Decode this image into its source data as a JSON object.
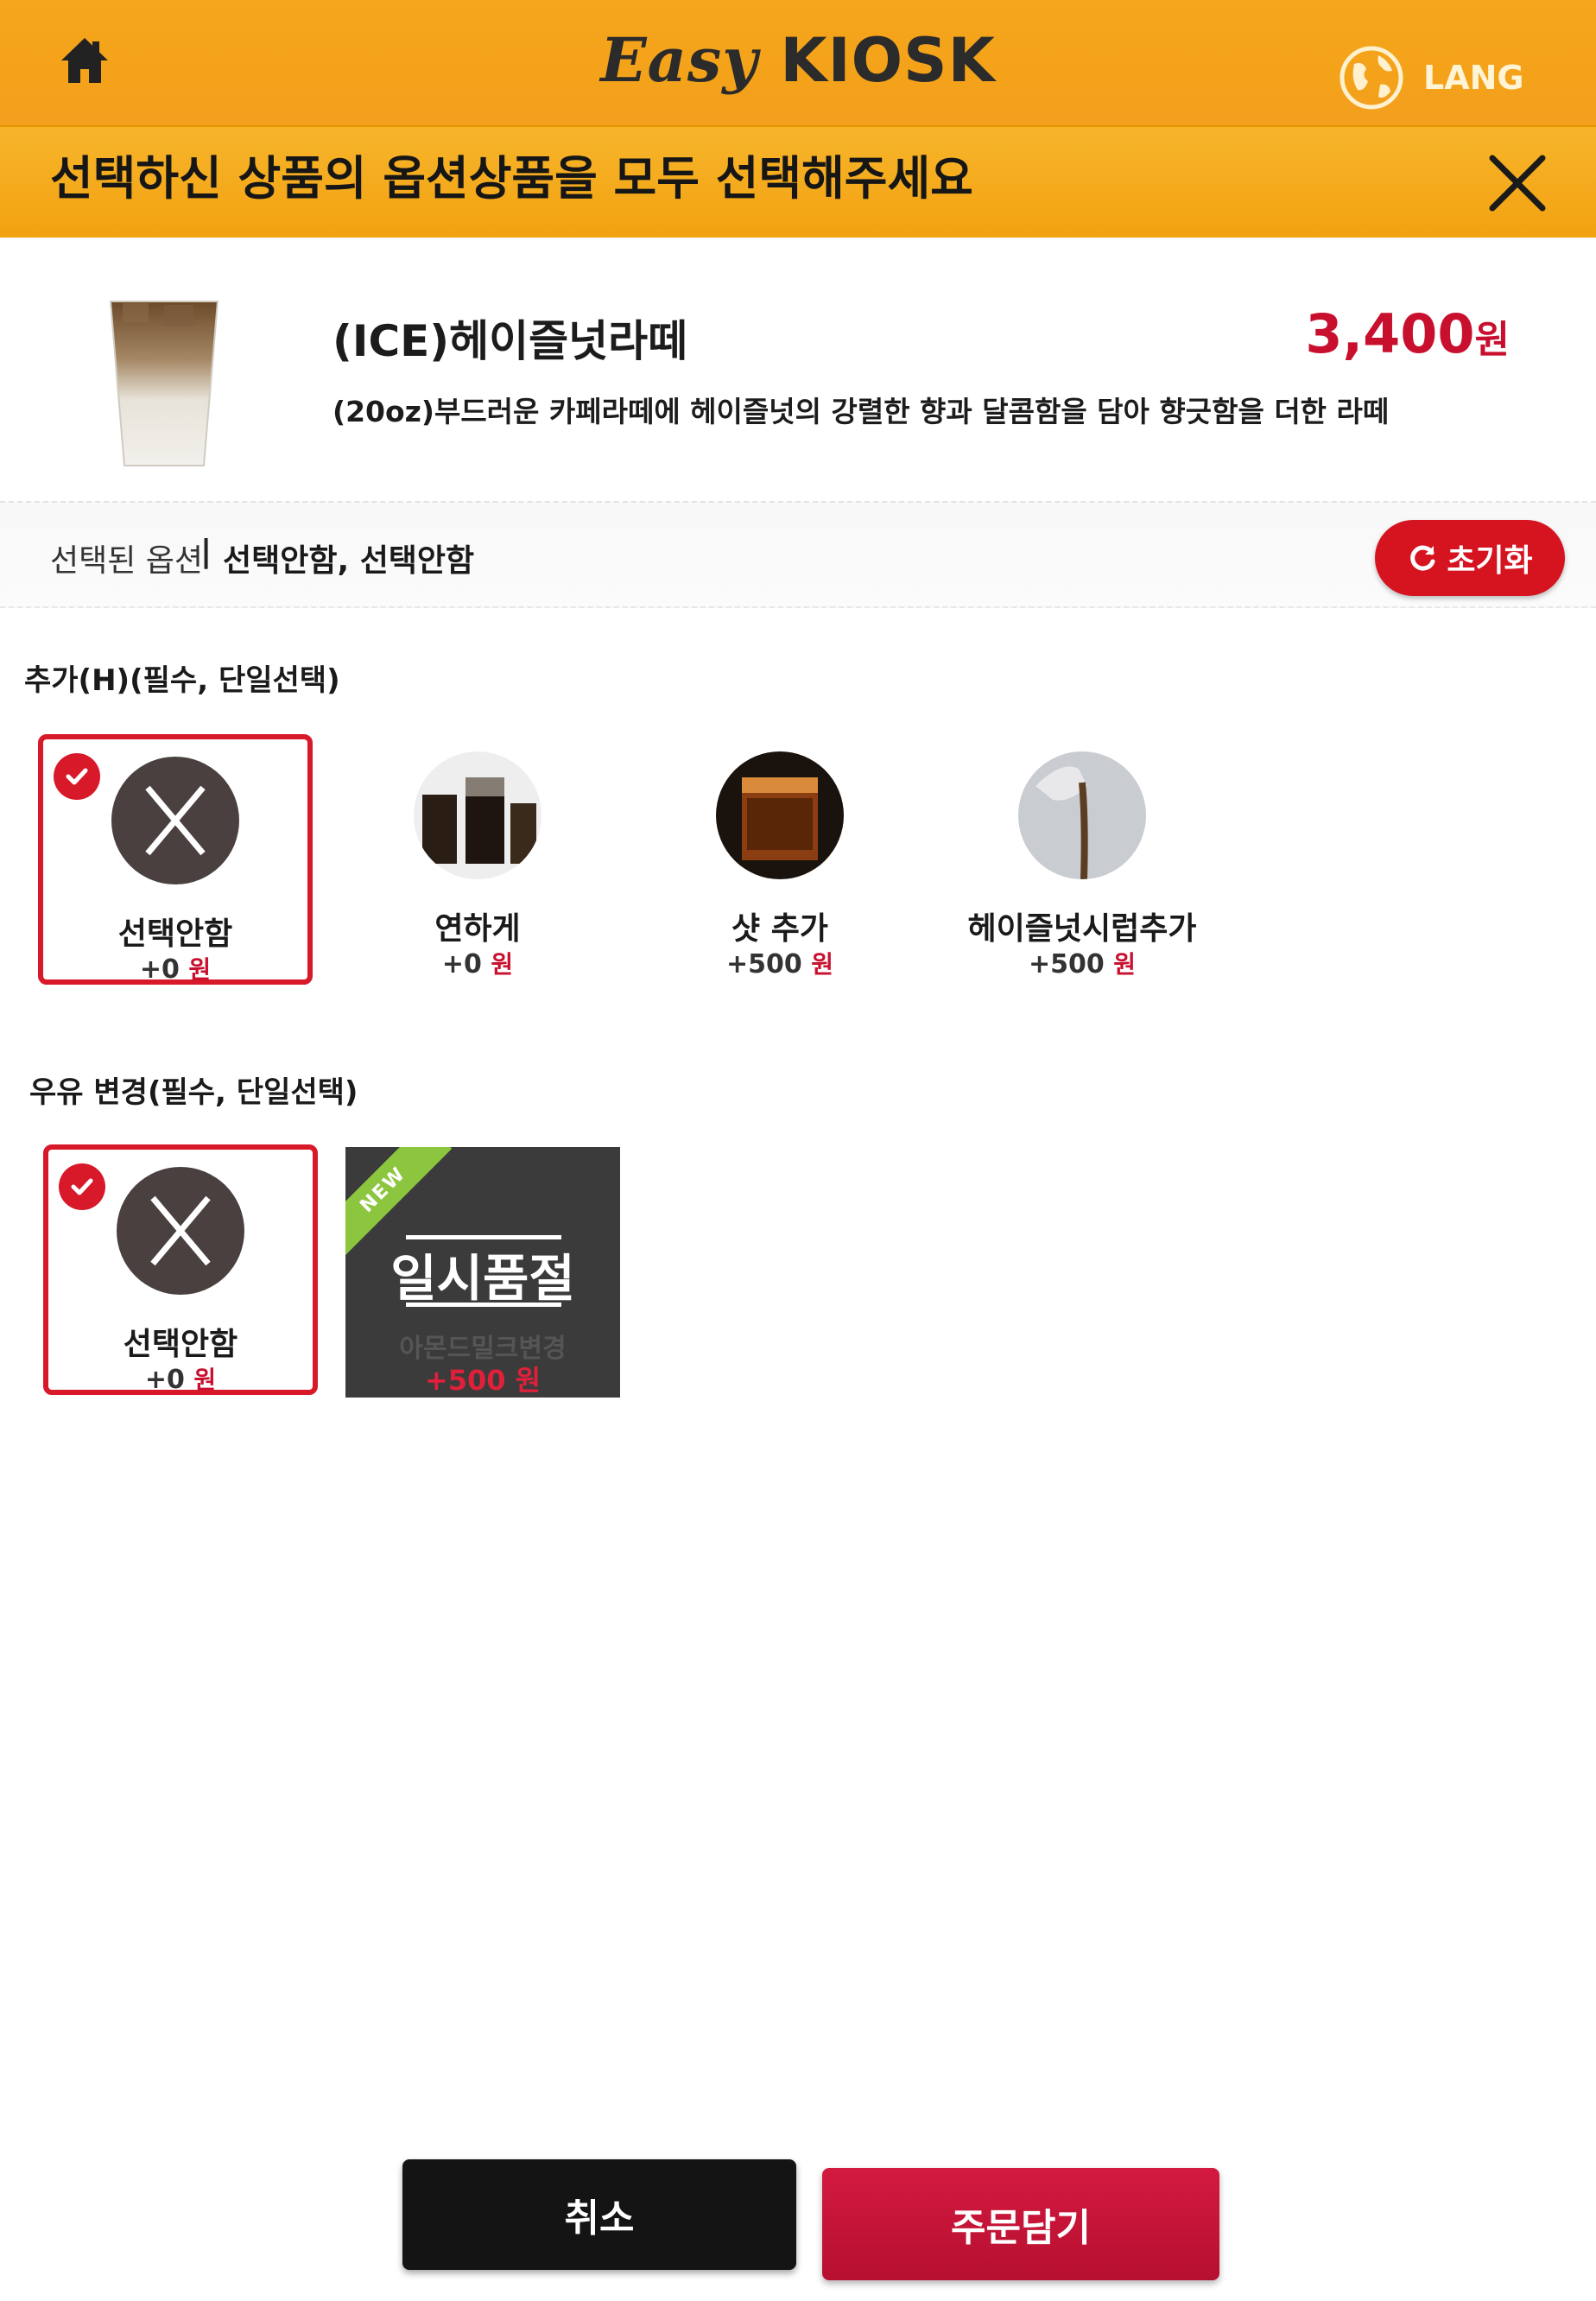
{
  "header": {
    "home_icon": "home-icon",
    "logo_easy": "Easy",
    "logo_kiosk": "KIOSK",
    "lang_icon": "globe-icon",
    "lang_label": "LANG"
  },
  "instruction": {
    "text": "선택하신 상품의 옵션상품을 모두 선택해주세요",
    "close_icon": "close-icon"
  },
  "product": {
    "name": "(ICE)헤이즐넛라떼",
    "price": "3,400",
    "currency": "원",
    "description": "(20oz)부드러운 카페라떼에 헤이즐넛의 강렬한 향과 달콤함을 담아 향긋함을 더한 라떼"
  },
  "selected_options": {
    "label": "선택된 옵션",
    "separator": "|",
    "value": "선택안함, 선택안함",
    "reset_label": "초기화"
  },
  "groups": [
    {
      "title": "추가(H)(필수, 단일선택)",
      "options": [
        {
          "label": "선택안함",
          "price": "+0",
          "currency": "원",
          "selected": true
        },
        {
          "label": "연하게",
          "price": "+0",
          "currency": "원",
          "selected": false
        },
        {
          "label": "샷 추가",
          "price": "+500",
          "currency": "원",
          "selected": false
        },
        {
          "label": "헤이즐넛시럽추가",
          "price": "+500",
          "currency": "원",
          "selected": false
        }
      ]
    },
    {
      "title": "우유 변경(필수, 단일선택)",
      "options": [
        {
          "label": "선택안함",
          "price": "+0",
          "currency": "원",
          "selected": true
        },
        {
          "badge": "NEW",
          "soldout_label": "일시품절",
          "label": "아몬드밀크변경",
          "price": "+500",
          "currency": "원",
          "sold_out": true
        }
      ]
    }
  ],
  "footer": {
    "cancel_label": "취소",
    "order_label": "주문담기"
  },
  "colors": {
    "brand_orange": "#f4a21a",
    "accent_red": "#d51420",
    "price_red": "#c8102e",
    "new_green": "#8cc63f"
  }
}
